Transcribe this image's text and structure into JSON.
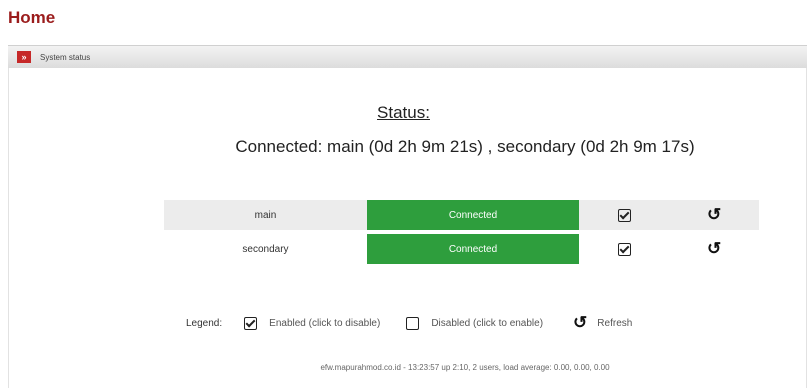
{
  "page": {
    "title": "Home"
  },
  "section": {
    "label": "System status",
    "icon": "chevron-right-icon"
  },
  "status": {
    "heading": "Status:",
    "summary": "Connected: main (0d 2h 9m 21s) , secondary (0d 2h 9m 17s)"
  },
  "connections": [
    {
      "name": "main",
      "state": "Connected",
      "enabled": true
    },
    {
      "name": "secondary",
      "state": "Connected",
      "enabled": true
    }
  ],
  "legend": {
    "label": "Legend:",
    "enabled": "Enabled (click to disable)",
    "disabled": "Disabled (click to enable)",
    "refresh": "Refresh"
  },
  "footer": {
    "text": "efw.mapurahmod.co.id - 13:23:57 up 2:10, 2 users, load average: 0.00, 0.00, 0.00"
  },
  "colors": {
    "title": "#9b1c1c",
    "connected": "#2e9e3d",
    "section_icon": "#c62828"
  }
}
